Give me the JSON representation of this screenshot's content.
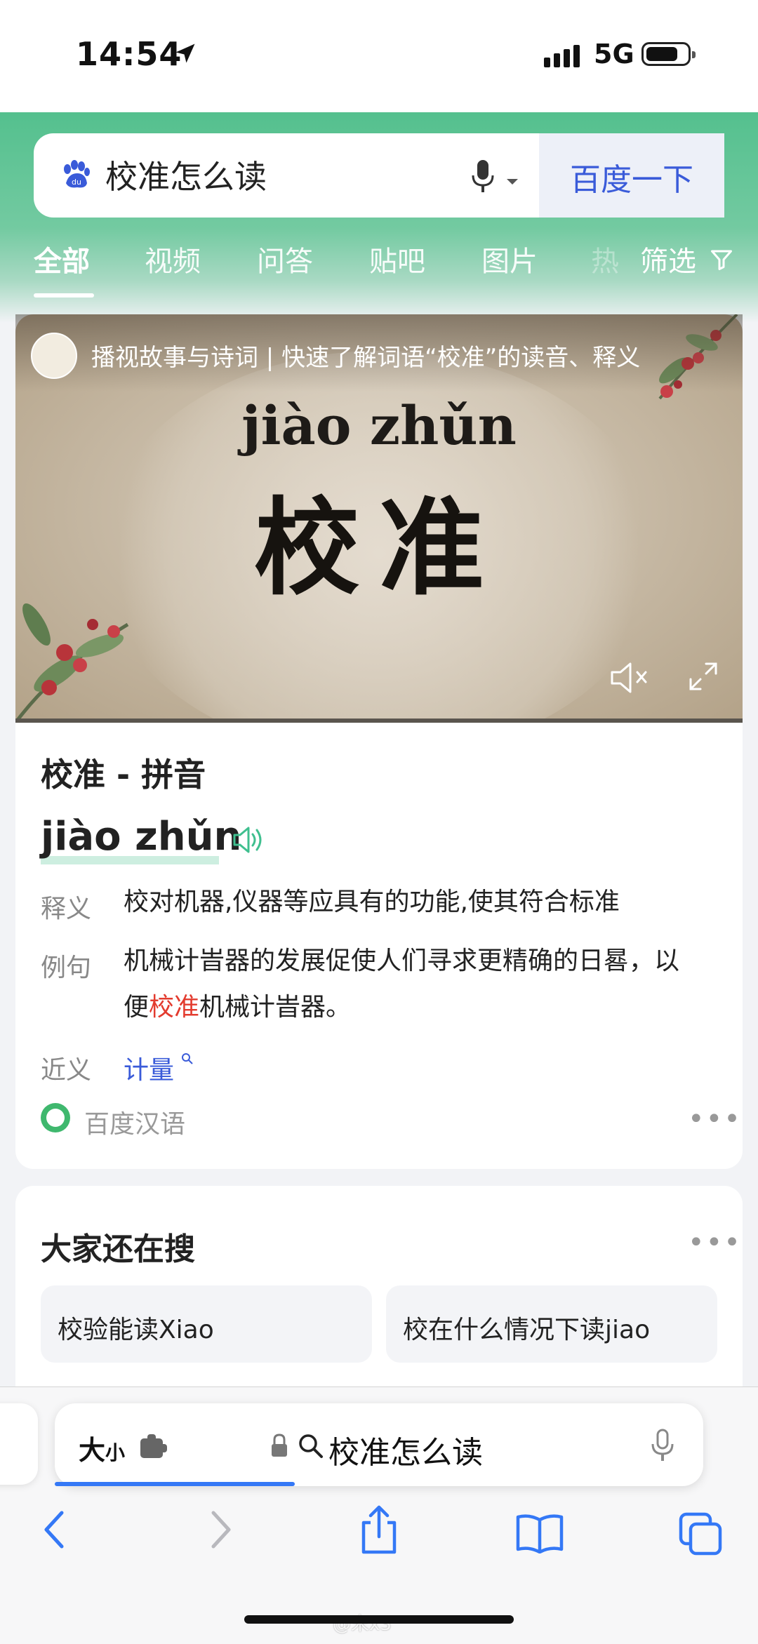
{
  "status_bar": {
    "time": "14:54",
    "network": "5G"
  },
  "search": {
    "query": "校准怎么读",
    "button_label": "百度一下"
  },
  "tabs": [
    "全部",
    "视频",
    "问答",
    "贴吧",
    "图片"
  ],
  "tab_hidden": "热",
  "filter_label": "筛选",
  "video": {
    "title": "播视故事与诗词 | 快速了解词语“校准”的读音、释义",
    "overlay_pinyin": "jiào zhǔn",
    "overlay_hanzi": "校准"
  },
  "dictionary": {
    "title": "校准 - 拼音",
    "pinyin": "jiào zhǔn",
    "definition_label": "释义",
    "definition": "校对机器,仪器等应具有的功能,使其符合标准",
    "example_label": "例句",
    "example_line1": "机械计旹器的发展促使人们寻求更精确的日晷，以",
    "example_prefix": "便",
    "example_highlight": "校准",
    "example_suffix": "机械计旹器。",
    "synonym_label": "近义",
    "synonym": "计量",
    "source": "百度汉语"
  },
  "related": {
    "title": "大家还在搜",
    "items": [
      "校验能读Xiao",
      "校在什么情况下读jiao"
    ]
  },
  "safari": {
    "text_size_big": "大",
    "text_size_small": "小",
    "url_text": "校准怎么读",
    "progress": 0.37
  },
  "watermark": "@宋x3",
  "colors": {
    "accent_green": "#54c08e",
    "link_blue": "#3a5bd9",
    "highlight_red": "#e33b2e",
    "safari_blue": "#3478f6"
  }
}
